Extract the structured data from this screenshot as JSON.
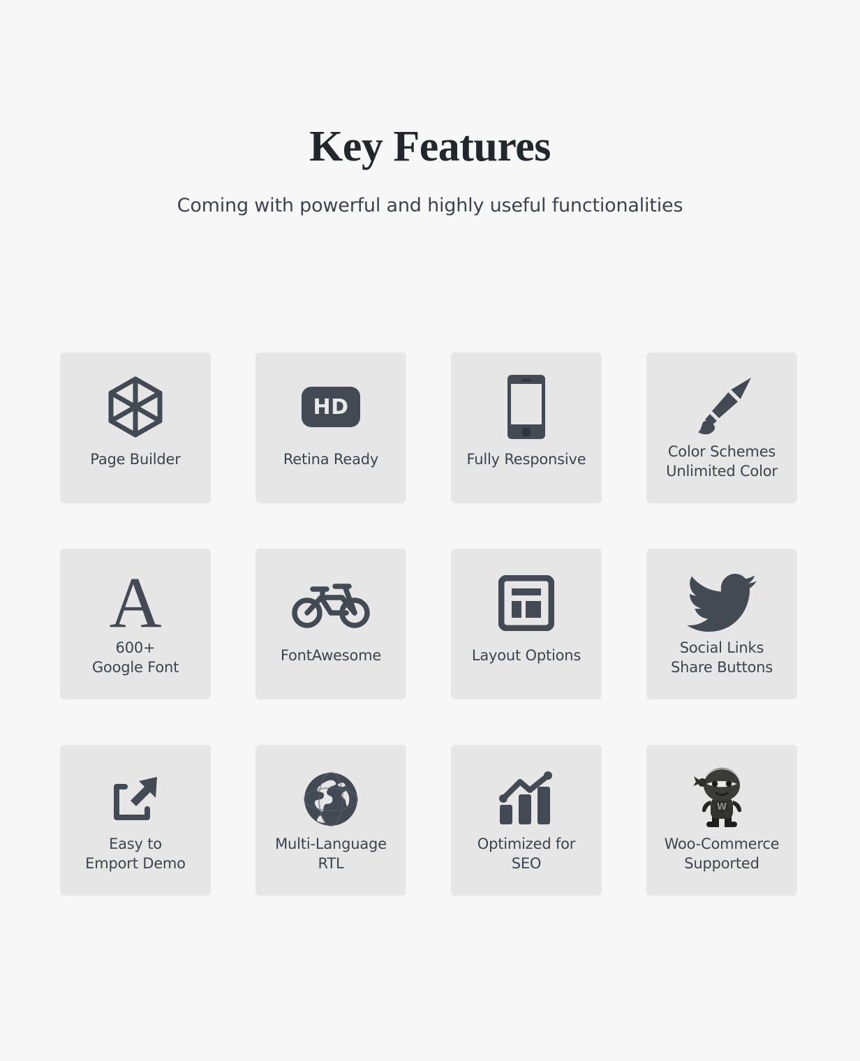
{
  "header": {
    "title": "Key Features",
    "subtitle": "Coming with powerful and highly useful functionalities"
  },
  "colors": {
    "background": "#f7f7f7",
    "card_background": "#e6e6e6",
    "icon": "#434a54",
    "title_text": "#23262b",
    "label_text": "#3d434c",
    "badge_text": "#e9eaec"
  },
  "features": [
    {
      "icon": "cube-outline-icon",
      "label": "Page Builder"
    },
    {
      "icon": "hd-badge-icon",
      "label": "Retina Ready",
      "badge_text": "HD"
    },
    {
      "icon": "mobile-phone-icon",
      "label": "Fully Responsive"
    },
    {
      "icon": "paint-brush-icon",
      "label": "Color Schemes\nUnlimited Color"
    },
    {
      "icon": "letter-a-serif-icon",
      "label": "600+\nGoogle Font",
      "glyph": "A"
    },
    {
      "icon": "bicycle-icon",
      "label": "FontAwesome"
    },
    {
      "icon": "layout-grid-icon",
      "label": "Layout Options"
    },
    {
      "icon": "twitter-bird-icon",
      "label": "Social Links\nShare Buttons"
    },
    {
      "icon": "import-arrow-icon",
      "label": "Easy to\nEmport Demo"
    },
    {
      "icon": "globe-icon",
      "label": "Multi-Language\nRTL"
    },
    {
      "icon": "bar-chart-growth-icon",
      "label": "Optimized for\nSEO"
    },
    {
      "icon": "woocommerce-ninja-icon",
      "label": "Woo-Commerce\nSupported"
    }
  ]
}
